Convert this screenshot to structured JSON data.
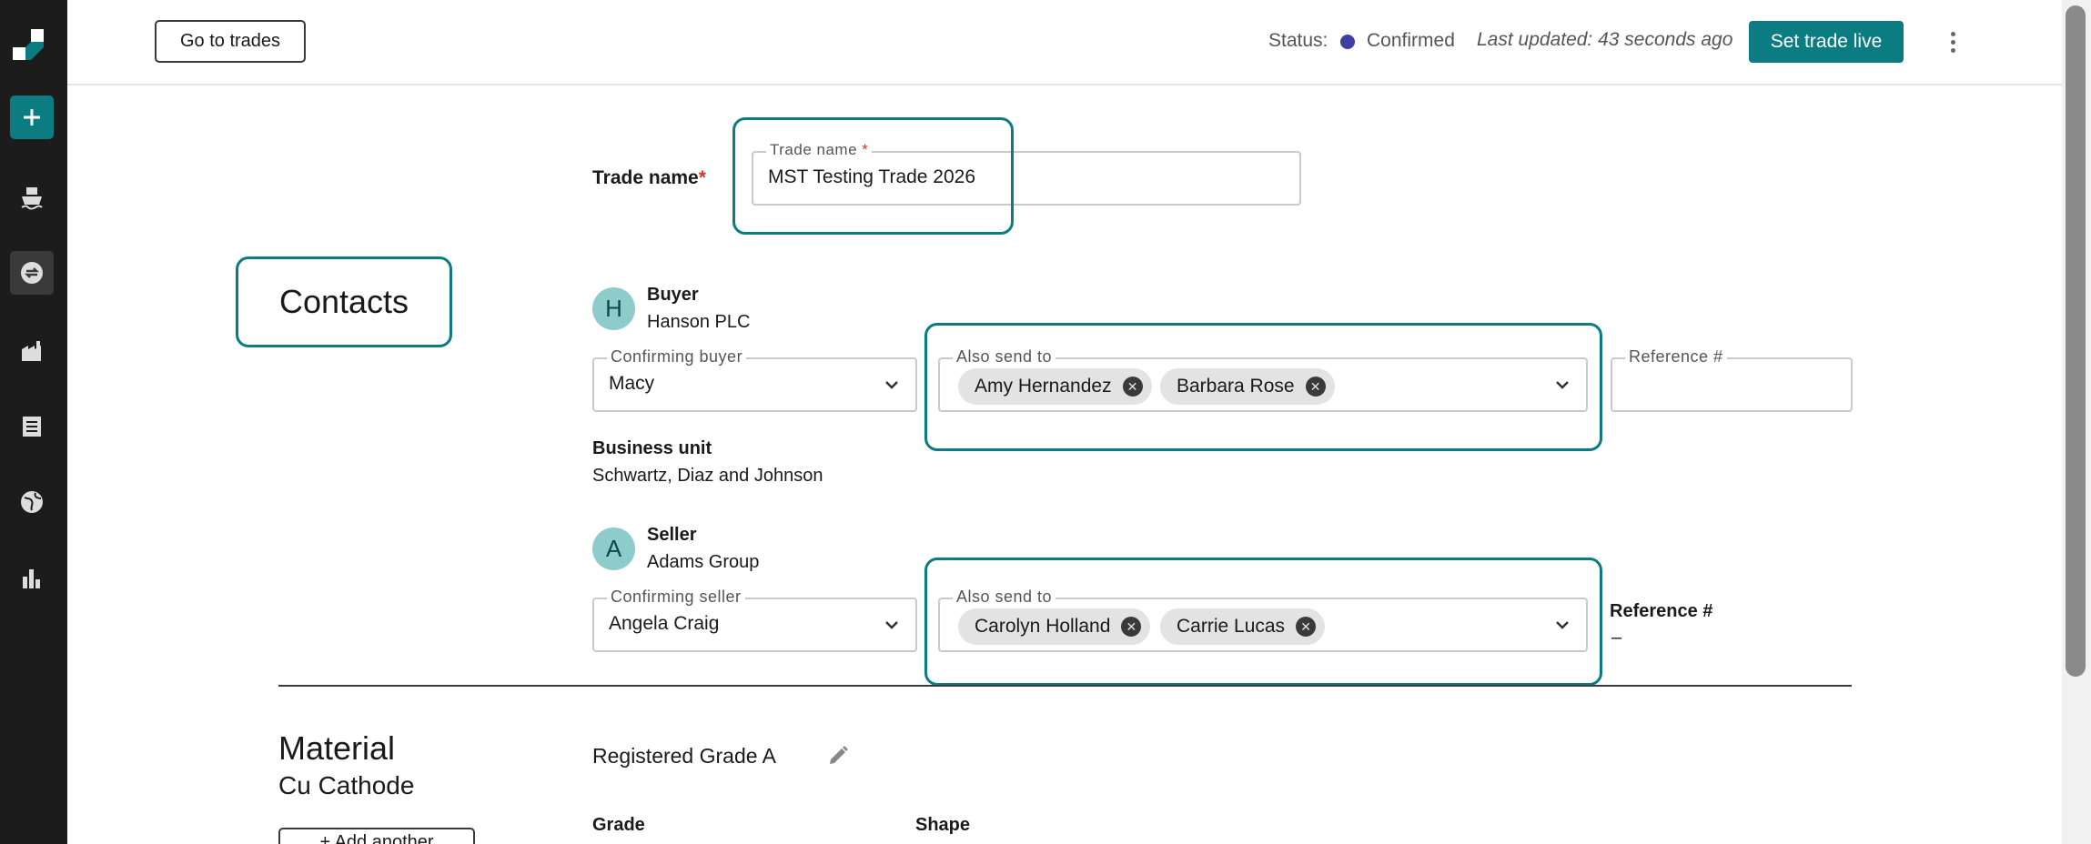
{
  "header": {
    "go_to_trades": "Go to trades",
    "status_label": "Status:",
    "status_value": "Confirmed",
    "status_color": "#3d3fa3",
    "last_updated": "Last updated: 43 seconds ago",
    "set_live": "Set trade live",
    "accent_color": "#0b7c82"
  },
  "sidebar": {
    "items": [
      {
        "icon": "plus-icon"
      },
      {
        "icon": "ship-icon"
      },
      {
        "icon": "trades-icon"
      },
      {
        "icon": "factory-icon"
      },
      {
        "icon": "document-icon"
      },
      {
        "icon": "globe-icon"
      },
      {
        "icon": "bar-chart-icon"
      }
    ]
  },
  "trade_name": {
    "label": "Trade name",
    "required": "*",
    "field_label": "Trade name",
    "value": "MST Testing Trade 2026"
  },
  "contacts": {
    "title": "Contacts",
    "buyer": {
      "initial": "H",
      "role": "Buyer",
      "company": "Hanson PLC",
      "confirming_label": "Confirming buyer",
      "confirming_value": "Macy",
      "also_send_label": "Also send to",
      "recipients": [
        "Amy Hernandez",
        "Barbara Rose"
      ],
      "reference_label": "Reference #",
      "business_unit_label": "Business unit",
      "business_unit_value": "Schwartz, Diaz and Johnson"
    },
    "seller": {
      "initial": "A",
      "role": "Seller",
      "company": "Adams Group",
      "confirming_label": "Confirming seller",
      "confirming_value": "Angela Craig",
      "also_send_label": "Also send to",
      "recipients": [
        "Carolyn Holland",
        "Carrie Lucas"
      ],
      "reference_label": "Reference #",
      "reference_value": "–"
    }
  },
  "material": {
    "title": "Material",
    "subtitle": "Cu Cathode",
    "add_another": "+ Add another",
    "grade_name": "Registered Grade A",
    "grade_label": "Grade",
    "shape_label": "Shape"
  }
}
